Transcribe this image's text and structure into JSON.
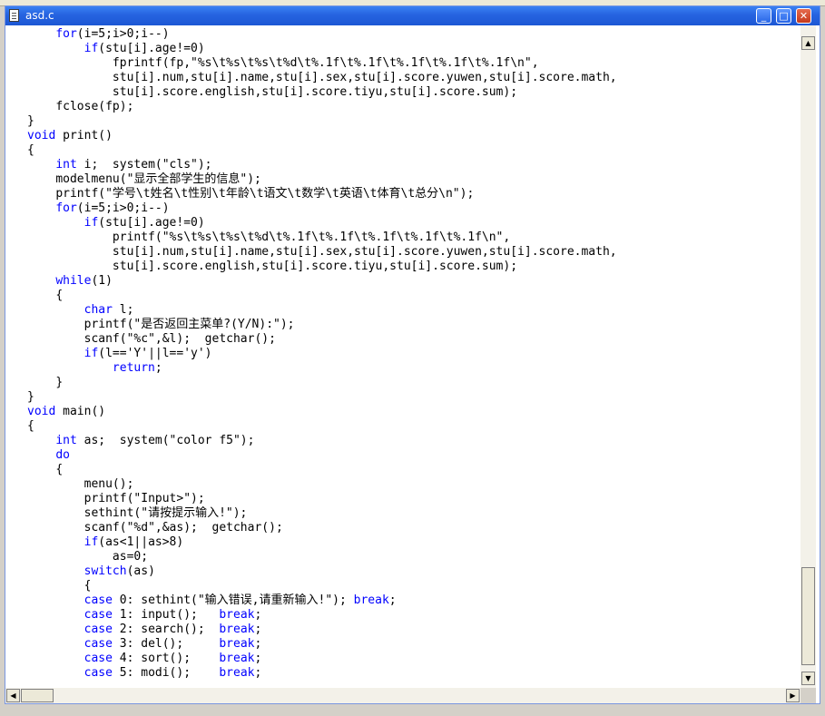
{
  "window": {
    "title": "asd.c",
    "minimize_glyph": "_",
    "maximize_glyph": "□",
    "close_glyph": "✕"
  },
  "icons": {
    "title_icon": "document-icon",
    "scroll_up": "▲",
    "scroll_down": "▼",
    "scroll_left": "◀",
    "scroll_right": "▶"
  },
  "colors": {
    "keyword": "#0000ff",
    "text": "#000000",
    "titlebar": "#2663e0"
  },
  "code": {
    "lines": [
      {
        "indent": "    ",
        "kw": "for",
        "rest": "(i=5;i>0;i--)"
      },
      {
        "indent": "        ",
        "kw": "if",
        "rest": "(stu[i].age!=0)"
      },
      {
        "indent": "            ",
        "kw": "",
        "rest": "fprintf(fp,\"%s\\t%s\\t%s\\t%d\\t%.1f\\t%.1f\\t%.1f\\t%.1f\\t%.1f\\n\","
      },
      {
        "indent": "            ",
        "kw": "",
        "rest": "stu[i].num,stu[i].name,stu[i].sex,stu[i].score.yuwen,stu[i].score.math,"
      },
      {
        "indent": "            ",
        "kw": "",
        "rest": "stu[i].score.english,stu[i].score.tiyu,stu[i].score.sum);"
      },
      {
        "indent": "    ",
        "kw": "",
        "rest": "fclose(fp);"
      },
      {
        "indent": "",
        "kw": "",
        "rest": "}"
      },
      {
        "indent": "",
        "kw": "void",
        "rest": " print()"
      },
      {
        "indent": "",
        "kw": "",
        "rest": "{"
      },
      {
        "indent": "    ",
        "kw": "int",
        "rest": " i;  system(\"cls\");"
      },
      {
        "indent": "    ",
        "kw": "",
        "rest": "modelmenu(\"显示全部学生的信息\");"
      },
      {
        "indent": "    ",
        "kw": "",
        "rest": "printf(\"学号\\t姓名\\t性别\\t年龄\\t语文\\t数学\\t英语\\t体育\\t总分\\n\");"
      },
      {
        "indent": "    ",
        "kw": "for",
        "rest": "(i=5;i>0;i--)"
      },
      {
        "indent": "        ",
        "kw": "if",
        "rest": "(stu[i].age!=0)"
      },
      {
        "indent": "            ",
        "kw": "",
        "rest": "printf(\"%s\\t%s\\t%s\\t%d\\t%.1f\\t%.1f\\t%.1f\\t%.1f\\t%.1f\\n\","
      },
      {
        "indent": "            ",
        "kw": "",
        "rest": "stu[i].num,stu[i].name,stu[i].sex,stu[i].score.yuwen,stu[i].score.math,"
      },
      {
        "indent": "            ",
        "kw": "",
        "rest": "stu[i].score.english,stu[i].score.tiyu,stu[i].score.sum);"
      },
      {
        "indent": "    ",
        "kw": "while",
        "rest": "(1)"
      },
      {
        "indent": "    ",
        "kw": "",
        "rest": "{"
      },
      {
        "indent": "        ",
        "kw": "char",
        "rest": " l;"
      },
      {
        "indent": "        ",
        "kw": "",
        "rest": "printf(\"是否返回主菜单?(Y/N):\");"
      },
      {
        "indent": "        ",
        "kw": "",
        "rest": "scanf(\"%c\",&l);  getchar();"
      },
      {
        "indent": "        ",
        "kw": "if",
        "rest": "(l=='Y'||l=='y')"
      },
      {
        "indent": "            ",
        "kw": "return",
        "rest": ";"
      },
      {
        "indent": "    ",
        "kw": "",
        "rest": "}"
      },
      {
        "indent": "",
        "kw": "",
        "rest": "}"
      },
      {
        "indent": "",
        "kw": "void",
        "rest": " main()"
      },
      {
        "indent": "",
        "kw": "",
        "rest": "{"
      },
      {
        "indent": "    ",
        "kw": "int",
        "rest": " as;  system(\"color f5\");"
      },
      {
        "indent": "    ",
        "kw": "do",
        "rest": ""
      },
      {
        "indent": "    ",
        "kw": "",
        "rest": "{"
      },
      {
        "indent": "        ",
        "kw": "",
        "rest": "menu();"
      },
      {
        "indent": "        ",
        "kw": "",
        "rest": "printf(\"Input>\");"
      },
      {
        "indent": "        ",
        "kw": "",
        "rest": "sethint(\"请按提示输入!\");"
      },
      {
        "indent": "        ",
        "kw": "",
        "rest": "scanf(\"%d\",&as);  getchar();"
      },
      {
        "indent": "        ",
        "kw": "if",
        "rest": "(as<1||as>8)"
      },
      {
        "indent": "            ",
        "kw": "",
        "rest": "as=0;"
      },
      {
        "indent": "        ",
        "kw": "switch",
        "rest": "(as)"
      },
      {
        "indent": "        ",
        "kw": "",
        "rest": "{"
      },
      {
        "indent": "        ",
        "kw": "case",
        "rest": " 0: sethint(\"输入错误,请重新输入!\"); ",
        "kw2": "break",
        "rest2": ";"
      },
      {
        "indent": "        ",
        "kw": "case",
        "rest": " 1: input();   ",
        "kw2": "break",
        "rest2": ";"
      },
      {
        "indent": "        ",
        "kw": "case",
        "rest": " 2: search();  ",
        "kw2": "break",
        "rest2": ";"
      },
      {
        "indent": "        ",
        "kw": "case",
        "rest": " 3: del();     ",
        "kw2": "break",
        "rest2": ";"
      },
      {
        "indent": "        ",
        "kw": "case",
        "rest": " 4: sort();    ",
        "kw2": "break",
        "rest2": ";"
      },
      {
        "indent": "        ",
        "kw": "case",
        "rest": " 5: modi();    ",
        "kw2": "break",
        "rest2": ";"
      }
    ]
  }
}
